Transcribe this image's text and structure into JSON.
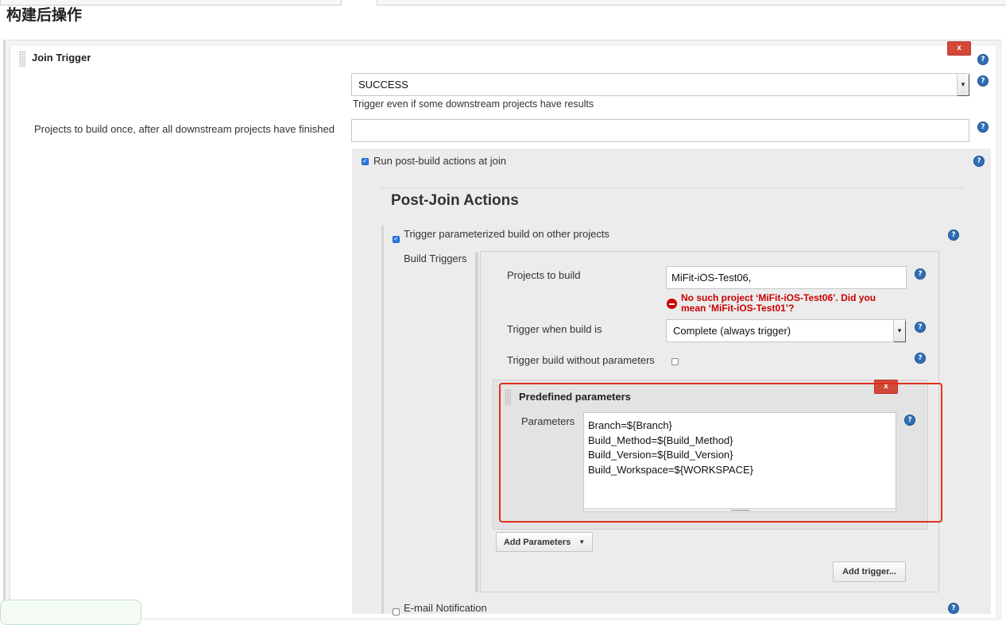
{
  "section": {
    "title": "构建后操作"
  },
  "join_trigger": {
    "title": "Join Trigger",
    "delete_label": "x",
    "result_select_value": "SUCCESS",
    "result_hint": "Trigger even if some downstream projects have results",
    "projects_label": "Projects to build once, after all downstream projects have finished",
    "projects_value": "",
    "run_post_build_label": "Run post-build actions at join",
    "post_join_title": "Post-Join Actions"
  },
  "param_trigger": {
    "checkbox_label": "Trigger parameterized build on other projects",
    "build_triggers_label": "Build Triggers",
    "projects_label": "Projects to build",
    "projects_value": "MiFit-iOS-Test06,",
    "error_text_line1": "No such project ‘MiFit-iOS-Test06’. Did you",
    "error_text_line2": "mean ‘MiFit-iOS-Test01’?",
    "trigger_when_label": "Trigger when build is",
    "trigger_when_value": "Complete (always trigger)",
    "without_params_label": "Trigger build without parameters",
    "predefined": {
      "title": "Predefined parameters",
      "delete_label": "x",
      "params_label": "Parameters",
      "params_value": "Branch=${Branch}\nBuild_Method=${Build_Method}\nBuild_Version=${Build_Version}\nBuild_Workspace=${WORKSPACE}"
    },
    "add_parameters_label": "Add Parameters",
    "add_trigger_label": "Add trigger..."
  },
  "email": {
    "label": "E-mail Notification"
  },
  "colors": {
    "delete_red": "#d24939",
    "help_blue": "#2f6fb7",
    "error_red": "#cc0000",
    "highlight_red": "#e0301e",
    "checkbox_blue": "#2c7be5"
  }
}
